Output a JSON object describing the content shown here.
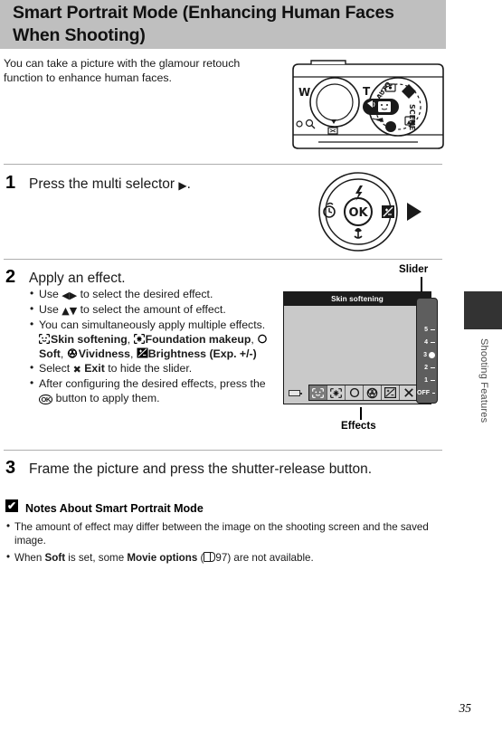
{
  "header": {
    "title": "Smart Portrait Mode (Enhancing Human Faces When Shooting)"
  },
  "sidebar": {
    "section_label": "Shooting Features"
  },
  "page": {
    "number": "35"
  },
  "intro": {
    "text": "You can take a picture with the glamour retouch function to enhance human faces."
  },
  "camera_figure": {
    "name": "camera-top-view-mode-dial",
    "dial_labels": [
      "W",
      "T",
      "SCENE"
    ],
    "highlighted_mode": "smart-portrait"
  },
  "multi_selector_figure": {
    "center_label": "OK",
    "icons": {
      "top": "flash-icon",
      "left": "self-timer-icon",
      "right": "exposure-compensation-icon",
      "bottom": "macro-icon",
      "pointer": "right-arrow-icon"
    }
  },
  "steps": [
    {
      "number": "1",
      "title_pre": "Press the multi selector ",
      "title_post": "."
    },
    {
      "number": "2",
      "title": "Apply an effect.",
      "bullets": [
        {
          "pre": "Use ",
          "mid": "",
          "post": " to select the desired effect.",
          "glyphs": "left-right-arrows"
        },
        {
          "pre": "Use ",
          "mid": "",
          "post": " to select the amount of effect.",
          "glyphs": "up-down-arrows"
        },
        {
          "pre": "You can simultaneously apply multiple effects.",
          "post": ""
        },
        {
          "pre": "Select ",
          "post": " to hide the slider.",
          "label": "Exit"
        },
        {
          "pre": "After configuring the desired effects, press the ",
          "post": " button to apply them."
        }
      ],
      "effect_names": [
        "Skin softening",
        "Foundation makeup",
        "Soft",
        "Vividness",
        "Brightness (Exp. +/-)"
      ]
    },
    {
      "number": "3",
      "title": "Frame the picture and press the shutter-release button."
    }
  ],
  "lcd": {
    "title": "Skin softening",
    "slider": {
      "label": "Slider",
      "values": [
        "5",
        "4",
        "3",
        "2",
        "1",
        "OFF"
      ],
      "selected": "3"
    },
    "effects": {
      "label": "Effects",
      "items": [
        {
          "name": "skin-softening-icon",
          "selected": true
        },
        {
          "name": "foundation-makeup-icon",
          "selected": false
        },
        {
          "name": "soft-icon",
          "selected": false
        },
        {
          "name": "vividness-icon",
          "selected": false
        },
        {
          "name": "brightness-icon",
          "selected": false
        },
        {
          "name": "exit-icon",
          "selected": false
        }
      ]
    },
    "battery_icon": "battery-icon"
  },
  "notes": {
    "heading": "Notes About Smart Portrait Mode",
    "items": [
      {
        "text": "The amount of effect may differ between the image on the shooting screen and the saved image."
      },
      {
        "pre": "When ",
        "bold1": "Soft",
        "mid": " is set, some ",
        "bold2": "Movie options",
        "ref_open": "(",
        "ref_page": "97",
        "post": ") are not available."
      }
    ]
  },
  "colors": {
    "header_band": "#bfbfbf",
    "side_tab": "#333333",
    "lcd_body": "#c9c9c9",
    "lcd_titlebar": "#1c1c1c",
    "slider_body": "#5e5e5e"
  }
}
